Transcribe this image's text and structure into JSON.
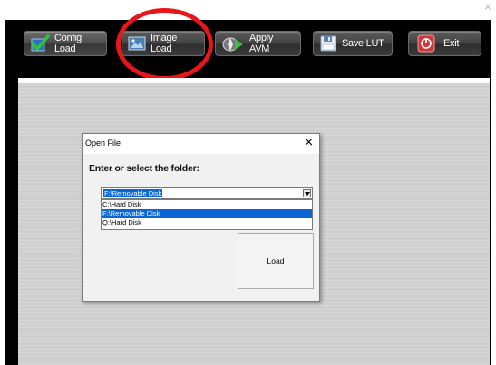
{
  "window": {
    "close_glyph": "×"
  },
  "toolbar": {
    "buttons": [
      {
        "label": "Config Load",
        "icon": "checkmark-icon"
      },
      {
        "label": "Image Load",
        "icon": "image-icon"
      },
      {
        "label": "Apply AVM",
        "icon": "apply-avm-icon"
      },
      {
        "label": "Save LUT",
        "icon": "floppy-disk-icon"
      },
      {
        "label": "Exit",
        "icon": "power-icon"
      }
    ]
  },
  "annotation": {
    "color": "#e8151b",
    "target": "Image Load"
  },
  "dialog": {
    "title": "Open File",
    "close_glyph": "×",
    "prompt": "Enter or select the folder:",
    "selected_folder": "F:\\Removable Disk",
    "folder_options": [
      "C:\\Hard Disk",
      "F:\\Removable Disk",
      "Q:\\Hard Disk"
    ],
    "highlighted_index": 1,
    "load_label": "Load"
  },
  "colors": {
    "selection": "#0a66d6",
    "app_background": "#000000",
    "panel_background": "#cfcfcf"
  }
}
